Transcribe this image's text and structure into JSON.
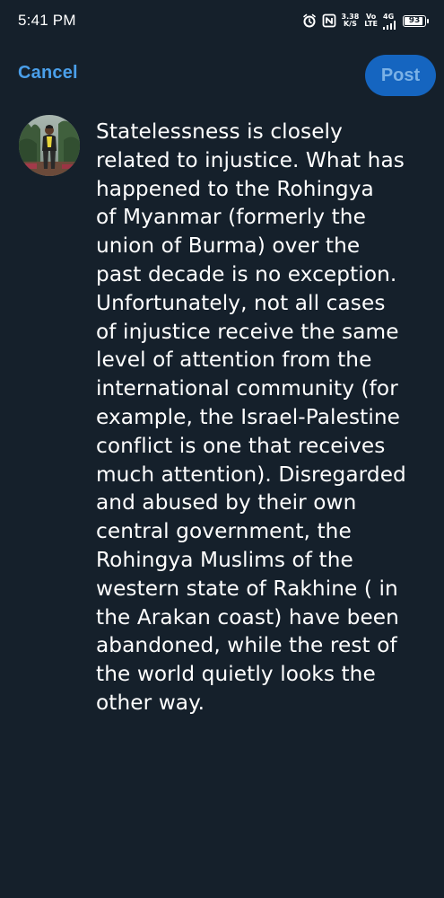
{
  "status_bar": {
    "time": "5:41 PM",
    "icons": [
      "alarm-icon",
      "nfc-icon"
    ],
    "speed_value": "3.38",
    "speed_unit": "K/S",
    "volte_top": "Vo",
    "volte_bottom": "LTE",
    "network_type": "4G",
    "battery_level": "93",
    "battery_fraction": 0.93
  },
  "header": {
    "cancel_label": "Cancel",
    "post_label": "Post"
  },
  "compose": {
    "avatar": "user-avatar",
    "text": "Statelessness is closely\nrelated to injustice. What has\nhappened to the Rohingya\nof Myanmar (formerly the\nunion of Burma) over the\npast decade is no exception.\nUnfortunately, not all cases\nof injustice receive the same\nlevel of attention from the\ninternational community (for\nexample, the Israel-Palestine\nconflict is one that receives\nmuch attention). Disregarded\nand abused by their own\ncentral government, the\nRohingya Muslims of the\nwestern state of Rakhine ( in\nthe Arakan coast) have been\nabandoned, while the rest of\nthe world quietly looks the\nother way."
  },
  "colors": {
    "background": "#15202b",
    "accent": "#4a9fea",
    "post_button_bg": "#1565c0",
    "post_button_text": "#7ab1e6"
  }
}
